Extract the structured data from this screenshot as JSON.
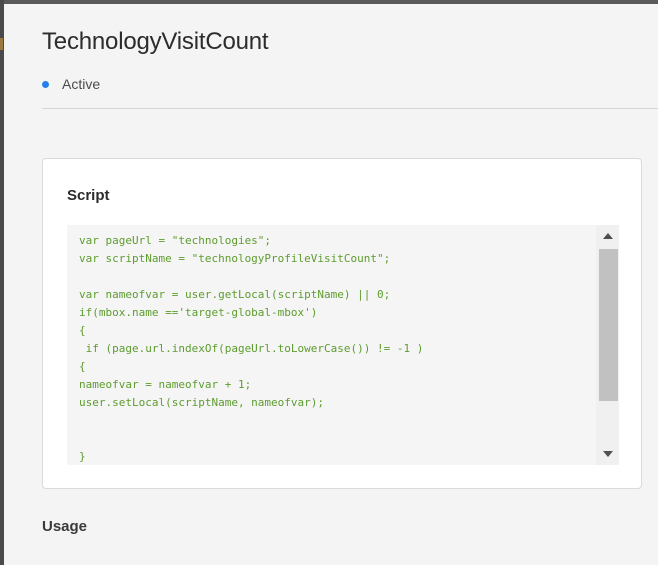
{
  "page": {
    "title": "TechnologyVisitCount",
    "status": {
      "label": "Active",
      "color": "#2680eb"
    }
  },
  "script_card": {
    "heading": "Script",
    "code": "var pageUrl = \"technologies\";\nvar scriptName = \"technologyProfileVisitCount\";\n\nvar nameofvar = user.getLocal(scriptName) || 0;\nif(mbox.name =='target-global-mbox')\n{\n if (page.url.indexOf(pageUrl.toLowerCase()) != -1 )\n{\nnameofvar = nameofvar + 1;\nuser.setLocal(scriptName, nameofvar);\n\n\n}",
    "code_color": "#5d9c2e"
  },
  "usage": {
    "heading": "Usage"
  },
  "icons": {
    "scroll_up": "triangle-up-icon",
    "scroll_down": "triangle-down-icon"
  }
}
